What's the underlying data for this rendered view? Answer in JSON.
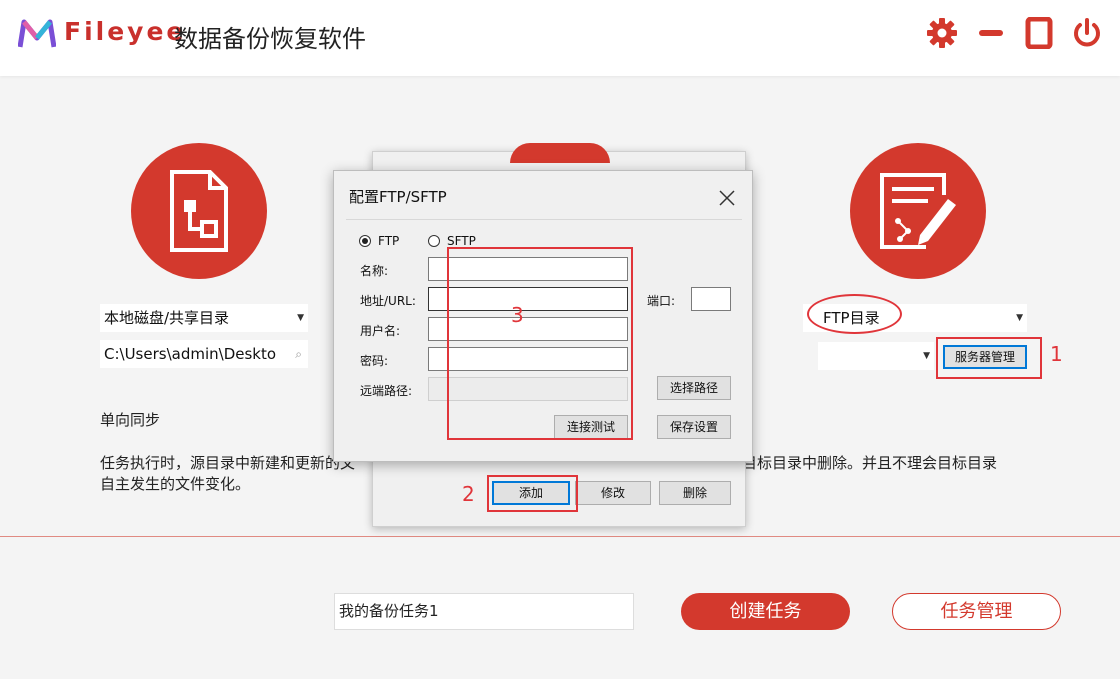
{
  "header": {
    "brand": "Fileyee",
    "app_title": "数据备份恢复软件",
    "icons": [
      "logo-icon",
      "gear-icon",
      "minimize-icon",
      "maximize-icon",
      "power-icon"
    ],
    "accent_color": "#d3392d"
  },
  "source": {
    "type_select": "本地磁盘/共享目录",
    "path": "C:\\Users\\admin\\Deskto"
  },
  "target": {
    "type_select": "FTP目录",
    "server_select": "",
    "server_manage_button": "服务器管理"
  },
  "sync": {
    "mode_label": "单向同步",
    "description_line1_left": "任务执行时，源目录中新建和更新的文",
    "description_line1_right": "目标目录中删除。并且不理会目标目录",
    "description_line2": "自主发生的文件变化。"
  },
  "server_dialog": {
    "add_button": "添加",
    "edit_button": "修改",
    "delete_button": "删除"
  },
  "ftp_dialog": {
    "title": "配置FTP/SFTP",
    "protocol_ftp": "FTP",
    "protocol_sftp": "SFTP",
    "protocol_selected": "FTP",
    "name_label": "名称:",
    "address_label": "地址/URL:",
    "port_label": "端口:",
    "user_label": "用户名:",
    "password_label": "密码:",
    "remote_path_label": "远端路径:",
    "choose_path_button": "选择路径",
    "test_connection_button": "连接测试",
    "save_button": "保存设置"
  },
  "footer": {
    "task_name": "我的备份任务1",
    "create_button": "创建任务",
    "manage_button": "任务管理"
  },
  "annotations": {
    "step1": "1",
    "step2": "2",
    "step3": "3",
    "color": "#e0353a"
  }
}
